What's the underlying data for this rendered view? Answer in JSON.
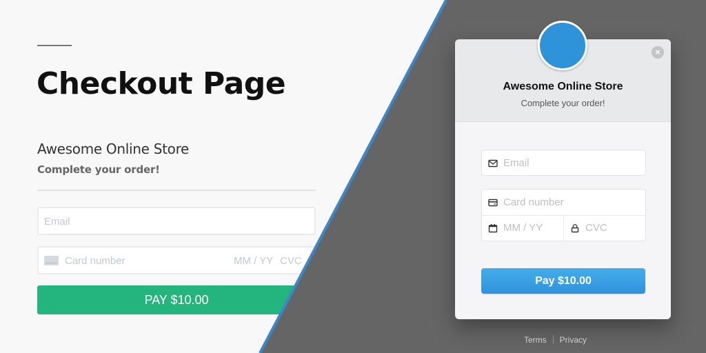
{
  "background_page": {
    "title": "Checkout Page",
    "store_name": "Awesome Online Store",
    "store_subtitle": "Complete your order!",
    "email_placeholder": "Email",
    "card_number_placeholder": "Card number",
    "expiry_placeholder": "MM / YY",
    "cvc_placeholder": "CVC",
    "pay_button_label": "PAY $10.00",
    "pay_button_color": "#24b47e"
  },
  "overlay": {
    "ghost_title": "Checkout Page",
    "divider_color": "#3b87c9",
    "overlay_color": "#656565"
  },
  "modal": {
    "logo_color": "#2e93d9",
    "close_icon": "close-circle-icon",
    "close_glyph": "×",
    "store_name": "Awesome Online Store",
    "subtitle": "Complete your order!",
    "email_placeholder": "Email",
    "card_number_placeholder": "Card number",
    "expiry_placeholder": "MM / YY",
    "cvc_placeholder": "CVC",
    "pay_button_label": "Pay $10.00",
    "pay_button_color": "#3a9fe2",
    "icons": {
      "email": "mail-icon",
      "card": "credit-card-icon",
      "expiry": "calendar-icon",
      "cvc": "lock-icon"
    }
  },
  "footer": {
    "terms_label": "Terms",
    "privacy_label": "Privacy"
  }
}
